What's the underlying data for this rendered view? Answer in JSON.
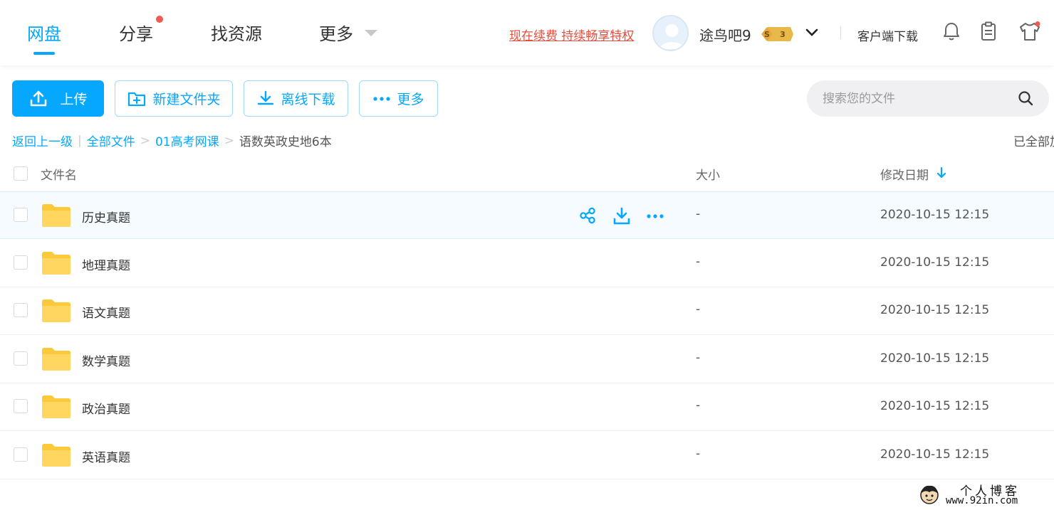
{
  "nav": {
    "tabs": [
      {
        "label": "网盘",
        "active": true
      },
      {
        "label": "分享",
        "has_dot": true
      },
      {
        "label": "找资源"
      },
      {
        "label": "更多"
      }
    ],
    "renew_link": "现在续费 持续畅享特权",
    "username": "途鸟吧9",
    "vip_level": "3",
    "client_download": "客户端下载",
    "icons": [
      "bell-icon",
      "clipboard-icon",
      "shirt-icon"
    ],
    "accent_color": "#06a7ff",
    "notice_color": "#f4584f"
  },
  "toolbar": {
    "upload_label": "上传",
    "new_folder_label": "新建文件夹",
    "offline_download_label": "离线下载",
    "more_label": "更多",
    "search_placeholder": "搜索您的文件"
  },
  "breadcrumb": {
    "back": "返回上一级",
    "items": [
      "全部文件",
      "01高考网课"
    ],
    "current": "语数英政史地6本",
    "loaded_status": "已全部加载"
  },
  "table": {
    "columns": {
      "name": "文件名",
      "size": "大小",
      "modified": "修改日期"
    },
    "rows": [
      {
        "name": "历史真题",
        "size": "-",
        "modified": "2020-10-15 12:15"
      },
      {
        "name": "地理真题",
        "size": "-",
        "modified": "2020-10-15 12:15"
      },
      {
        "name": "语文真题",
        "size": "-",
        "modified": "2020-10-15 12:15"
      },
      {
        "name": "数学真题",
        "size": "-",
        "modified": "2020-10-15 12:15"
      },
      {
        "name": "政治真题",
        "size": "-",
        "modified": "2020-10-15 12:15"
      },
      {
        "name": "英语真题",
        "size": "-",
        "modified": "2020-10-15 12:15"
      }
    ]
  },
  "watermark": {
    "title": "个人博客",
    "url": "www.92in.com"
  }
}
